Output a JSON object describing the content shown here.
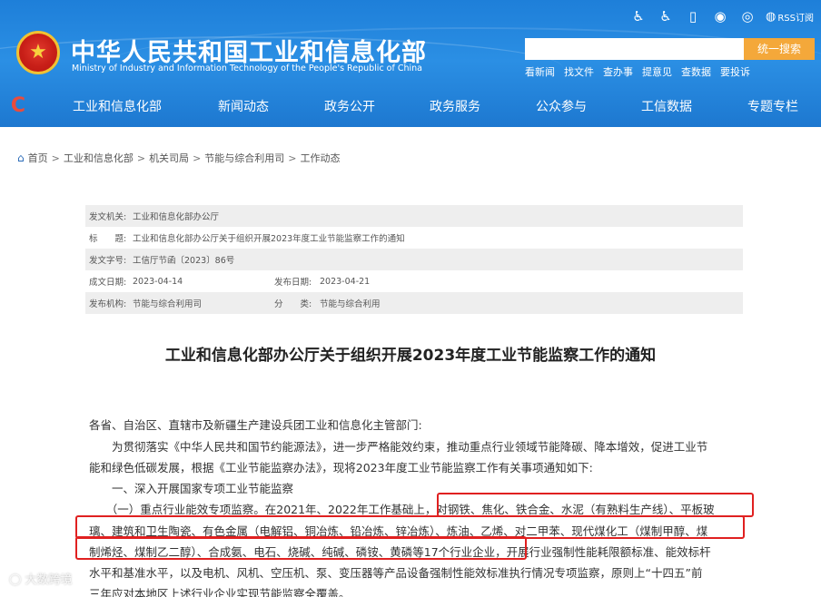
{
  "header": {
    "title": "中华人民共和国工业和信息化部",
    "subtitle": "Ministry of Industry and Information Technology of the People's Republic of China",
    "rss_label": "RSS订阅",
    "search_button": "统一搜索",
    "search_placeholder": "",
    "quick_links": [
      "看新闻",
      "找文件",
      "查办事",
      "提意见",
      "查数据",
      "要投诉"
    ],
    "util_icons": [
      "accessibility-elderly-icon",
      "wheelchair-icon",
      "mobile-icon",
      "wechat-icon",
      "app-icon",
      "weibo-icon"
    ]
  },
  "nav": {
    "items": [
      "工业和信息化部",
      "新闻动态",
      "政务公开",
      "政务服务",
      "公众参与",
      "工信数据",
      "专题专栏"
    ]
  },
  "breadcrumb": [
    "首页",
    "工业和信息化部",
    "机关司局",
    "节能与综合利用司",
    "工作动态"
  ],
  "meta": {
    "publisher_label": "发文机关:",
    "publisher": "工业和信息化部办公厅",
    "title_label": "标　　题:",
    "title": "工业和信息化部办公厅关于组织开展2023年度工业节能监察工作的通知",
    "doc_no_label": "发文字号:",
    "doc_no": "工信厅节函〔2023〕86号",
    "date_label": "成文日期:",
    "date": "2023-04-14",
    "pub_date_label": "发布日期:",
    "pub_date": "2023-04-21",
    "org_label": "发布机构:",
    "org": "节能与综合利用司",
    "cat_label": "分　　类:",
    "cat": "节能与综合利用"
  },
  "document": {
    "title": "工业和信息化部办公厅关于组织开展2023年度工业节能监察工作的通知",
    "lines": [
      "各省、自治区、直辖市及新疆生产建设兵团工业和信息化主管部门:",
      "　　为贯彻落实《中华人民共和国节约能源法》，进一步严格能效约束，推动重点行业领域节能降碳、降本增效，促进工业节",
      "能和绿色低碳发展，根据《工业节能监察办法》，现将2023年度工业节能监察工作有关事项通知如下:",
      "　　一、深入开展国家专项工业节能监察",
      "　　（一）重点行业能效专项监察。在2021年、2022年工作基础上，对钢铁、焦化、铁合金、水泥（有熟料生产线）、平板玻",
      "璃、建筑和卫生陶瓷、有色金属（电解铝、铜冶炼、铅冶炼、锌冶炼）、炼油、乙烯、对二甲苯、现代煤化工（煤制甲醇、煤",
      "制烯烃、煤制乙二醇）、合成氨、电石、烧碱、纯碱、磷铵、黄磷等17个行业企业，开展行业强制性能耗限额标准、能效标杆",
      "水平和基准水平，以及电机、风机、空压机、泵、变压器等产品设备强制性能效标准执行情况专项监察，原则上“十四五”前",
      "三年应对本地区上述行业企业实现节能监察全覆盖。"
    ]
  },
  "watermark": "大数跨境",
  "colors": {
    "header_blue": "#1e7fd9",
    "search_button": "#f4a83a",
    "highlight_red": "#e02020",
    "meta_grey": "#eeeeee"
  }
}
